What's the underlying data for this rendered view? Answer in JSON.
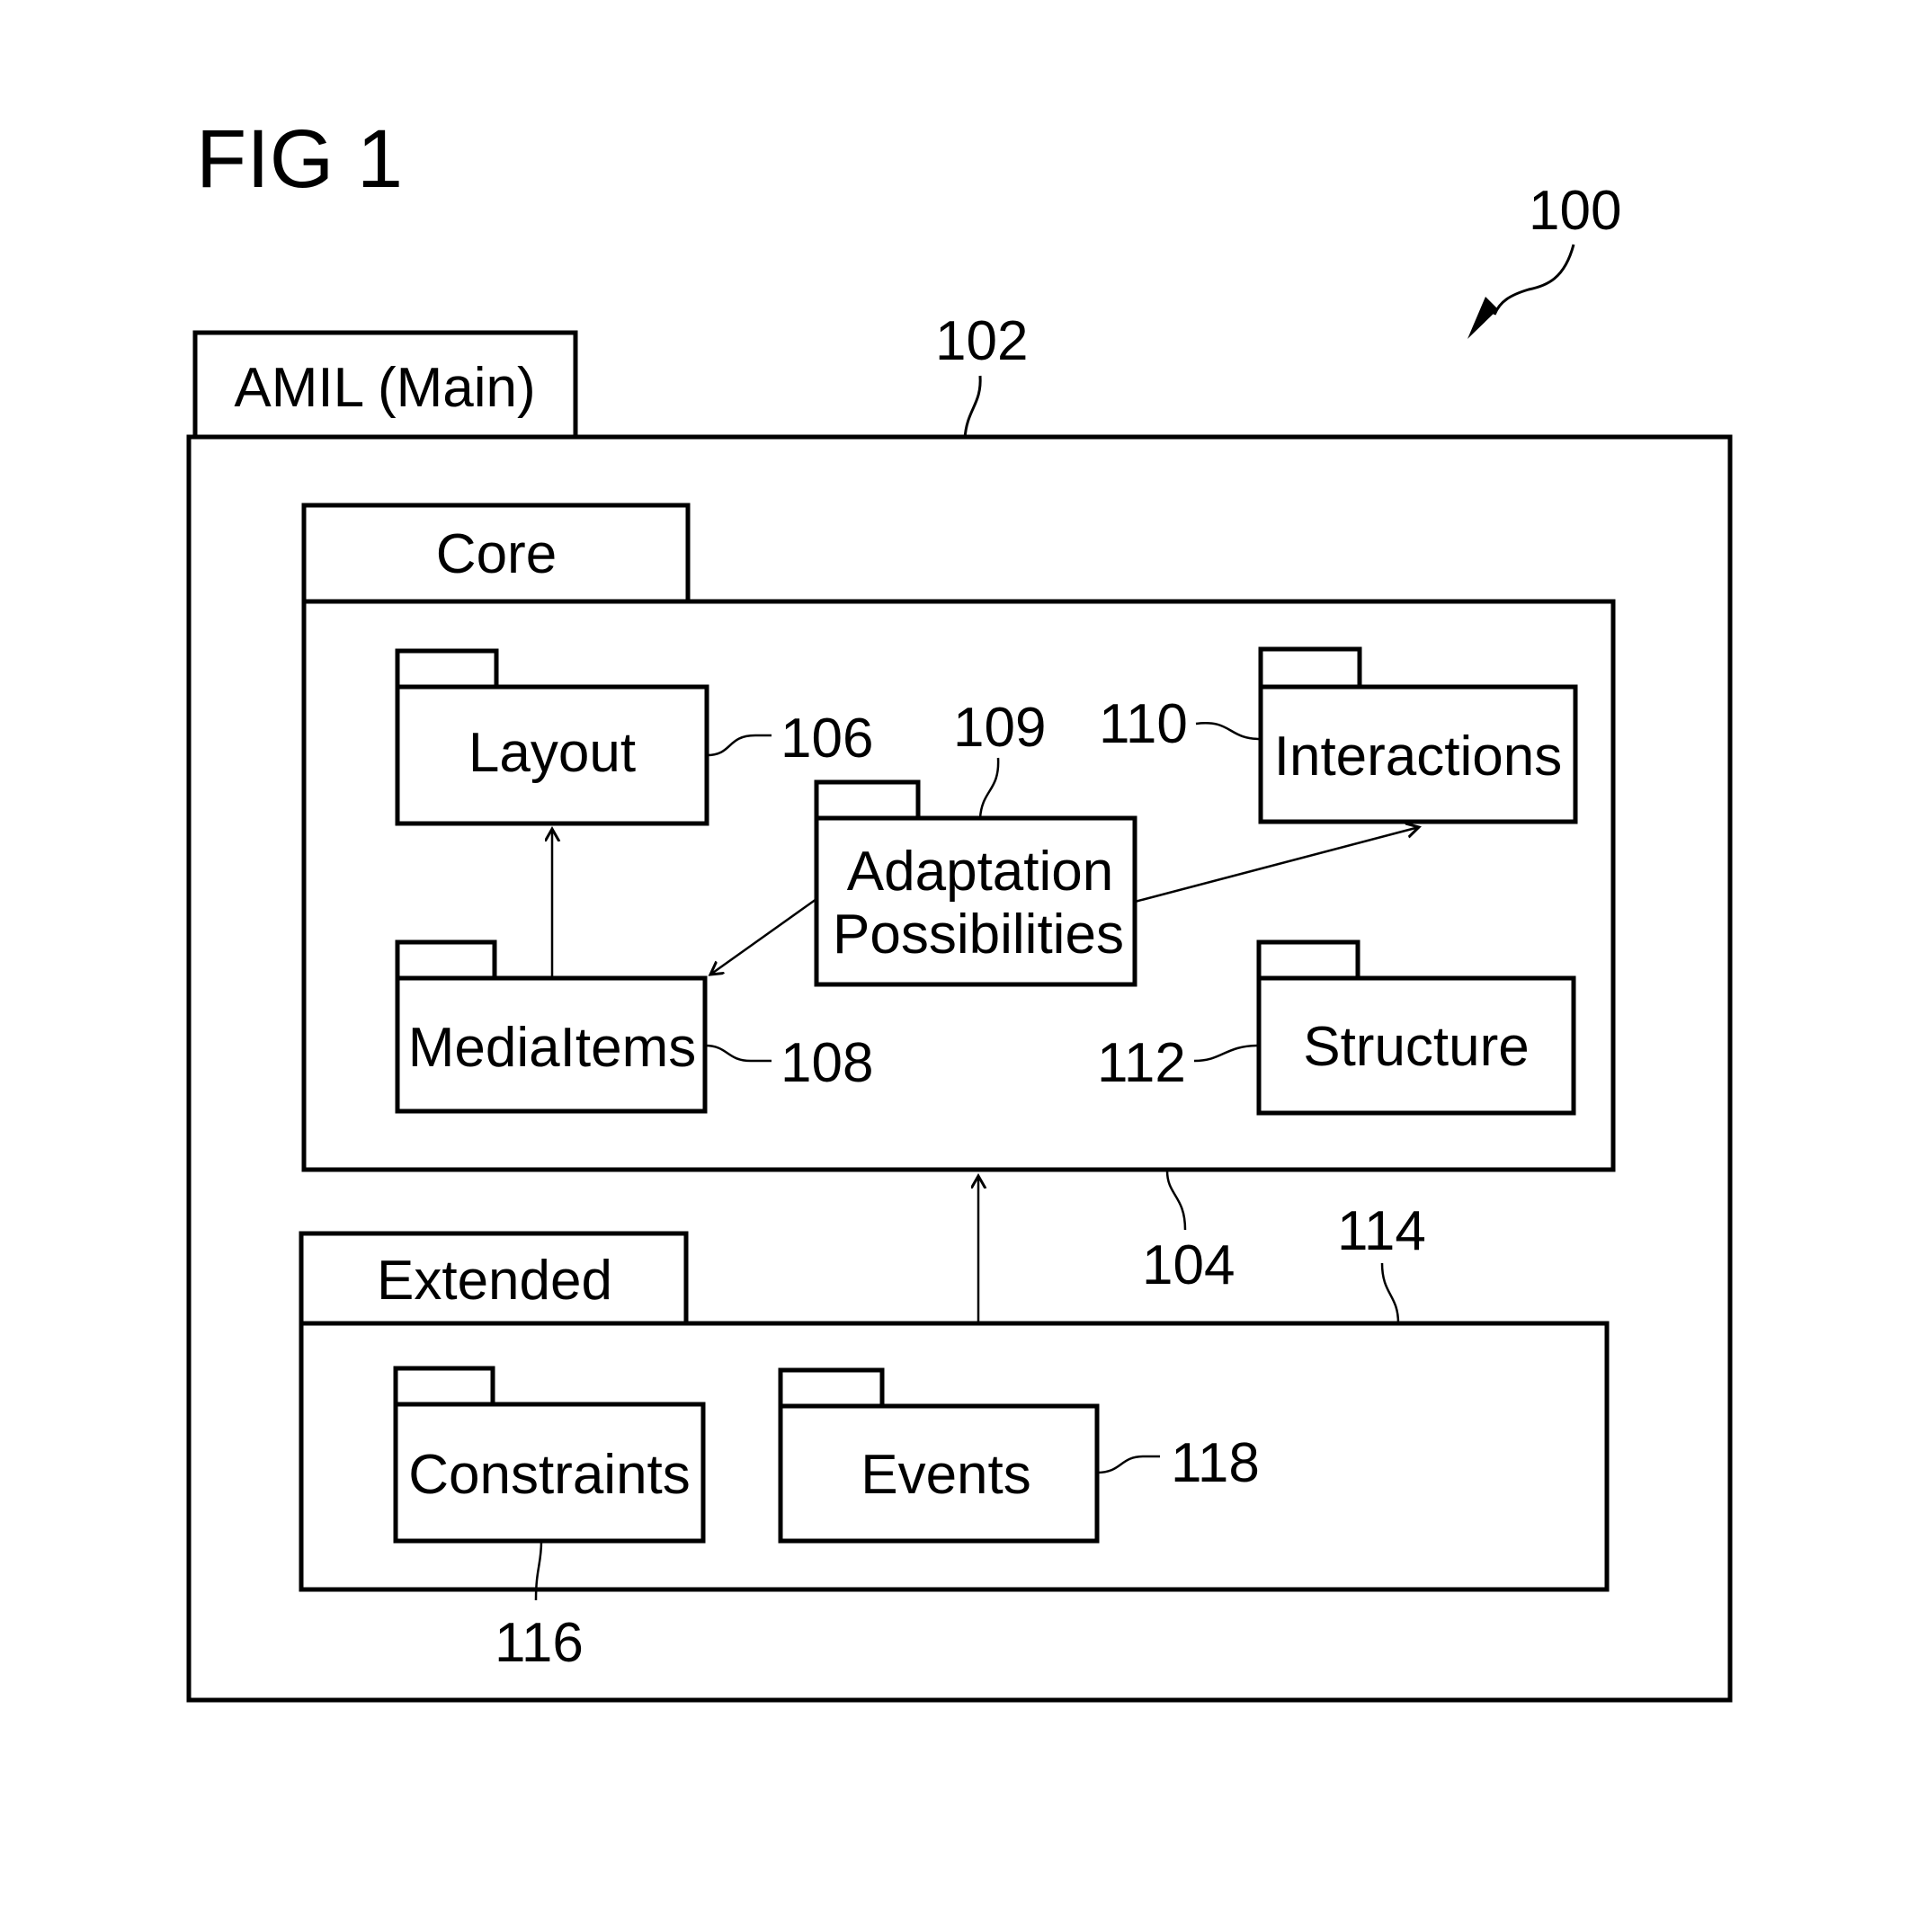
{
  "figure": {
    "title": "FIG 1",
    "ref_overall": "100"
  },
  "packages": {
    "main": {
      "label": "AMIL (Main)",
      "ref": "102"
    },
    "core": {
      "label": "Core",
      "ref": "104"
    },
    "extended": {
      "label": "Extended",
      "ref": "114"
    },
    "layout": {
      "label": "Layout",
      "ref": "106"
    },
    "media_items": {
      "label": "MediaItems",
      "ref": "108"
    },
    "adaptation": {
      "label_line1": "Adaptation",
      "label_line2": "Possibilities",
      "ref": "109"
    },
    "interactions": {
      "label": "Interactions",
      "ref": "110"
    },
    "structure": {
      "label": "Structure",
      "ref": "112"
    },
    "constraints": {
      "label": "Constraints",
      "ref": "116"
    },
    "events": {
      "label": "Events",
      "ref": "118"
    }
  },
  "relations": [
    {
      "from": "MediaItems",
      "to": "Layout"
    },
    {
      "from": "Adaptation Possibilities",
      "to": "MediaItems"
    },
    {
      "from": "Adaptation Possibilities",
      "to": "Interactions"
    },
    {
      "from": "Extended",
      "to": "Core"
    }
  ]
}
